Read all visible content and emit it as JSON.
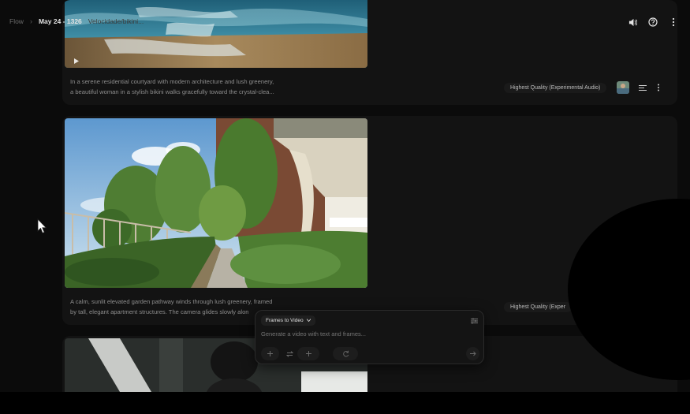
{
  "breadcrumb": {
    "root": "Flow",
    "project": "May 24 - 1326",
    "faded": "Velocidade/bikini..."
  },
  "topbar_icons": [
    "volume-icon",
    "help-icon",
    "more-vertical-icon"
  ],
  "cards": [
    {
      "prompt_line1": "In a serene residential courtyard with modern architecture and lush greenery,",
      "prompt_line2": "a beautiful woman in a stylish bikini walks gracefully toward the crystal-clea...",
      "quality": "Highest Quality (Experimental Audio)"
    },
    {
      "prompt_line1": "A calm, sunlit elevated garden pathway winds through lush greenery, framed",
      "prompt_line2": "by tall, elegant apartment structures. The camera glides slowly alon",
      "quality": "Highest Quality (Exper"
    }
  ],
  "composer": {
    "mode": "Frames to Video",
    "placeholder": "Generate a video with text and frames..."
  }
}
